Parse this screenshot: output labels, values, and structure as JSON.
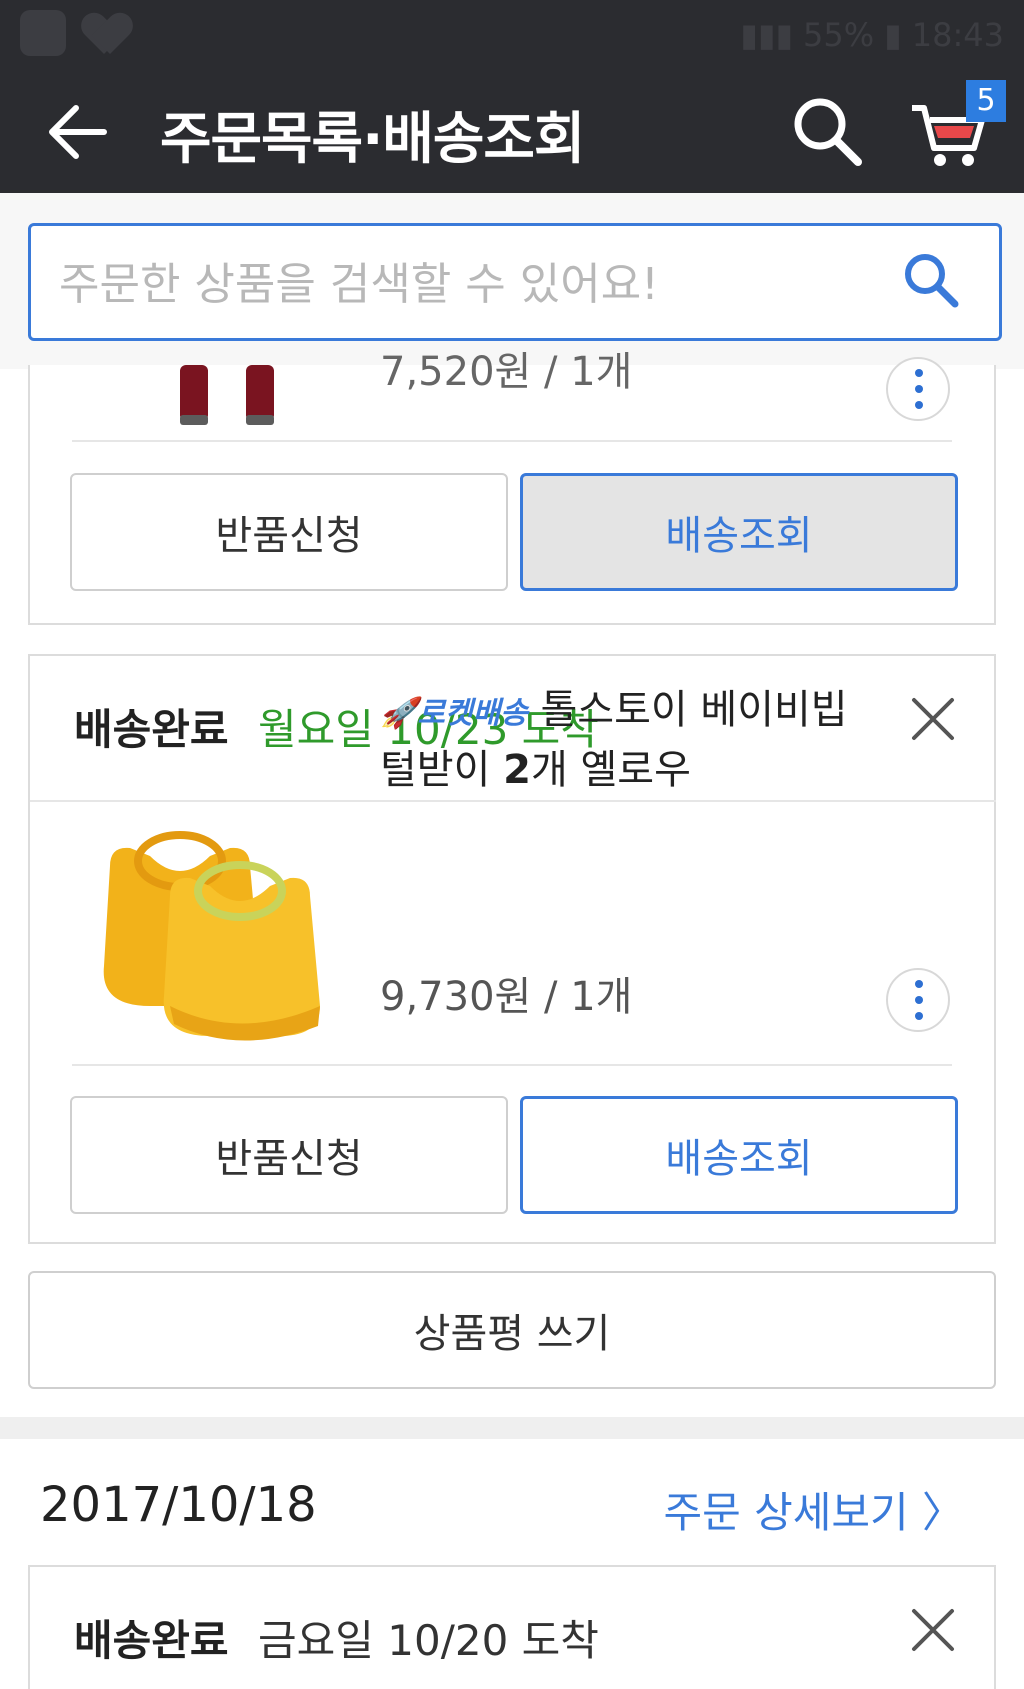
{
  "status_bar": {
    "battery": "55%",
    "time": "18:43"
  },
  "app_bar": {
    "title": "주문목록·배송조회",
    "cart_count": "5",
    "icons": [
      "back-arrow-icon",
      "search-icon",
      "cart-icon"
    ]
  },
  "search": {
    "placeholder": "주문한 상품을 검색할 수 있어요!",
    "value": ""
  },
  "order_card_1": {
    "price_partial": "7,520원 / 1개",
    "buttons": {
      "return": "반품신청",
      "track": "배송조회"
    }
  },
  "order_card_2": {
    "status": "배송완료",
    "arrival": "월요일 10/23 도착",
    "rocket_label": "로켓배송",
    "product_name_part1": "톨스토이 베이비빕",
    "product_name_part2": "털받이 ",
    "product_name_bold": "2",
    "product_name_part3": "개 옐로우",
    "price": "9,730원 / 1개",
    "buttons": {
      "return": "반품신청",
      "track": "배송조회"
    }
  },
  "review_button": "상품평 쓰기",
  "order_group_2": {
    "date": "2017/10/18",
    "detail_link": "주문 상세보기 〉",
    "status": "배송완료",
    "arrival": "금요일 10/20 도착"
  },
  "colors": {
    "appbar": "#2b2c30",
    "accent_blue": "#3a7ad9",
    "arrival_green": "#2f9a2b"
  }
}
